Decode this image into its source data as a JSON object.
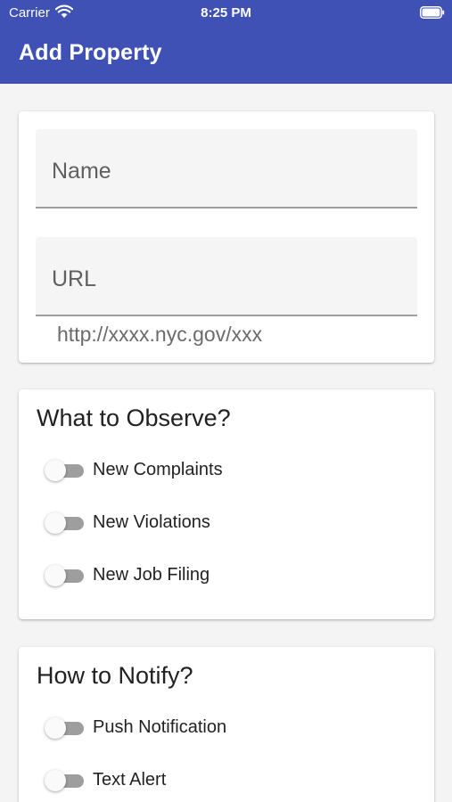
{
  "status_bar": {
    "carrier": "Carrier",
    "time": "8:25 PM",
    "icons": [
      "wifi-icon",
      "battery-icon"
    ]
  },
  "app_bar": {
    "title": "Add Property",
    "color": "#3f51b5"
  },
  "property_form": {
    "name_field": {
      "label": "Name",
      "value": ""
    },
    "url_field": {
      "label": "URL",
      "value": "",
      "helper_text": "http://xxxx.nyc.gov/xxx"
    }
  },
  "observe_section": {
    "title": "What to Observe?",
    "options": [
      {
        "label": "New Complaints",
        "enabled": false
      },
      {
        "label": "New Violations",
        "enabled": false
      },
      {
        "label": "New Job Filing",
        "enabled": false
      }
    ]
  },
  "notify_section": {
    "title": "How to Notify?",
    "options": [
      {
        "label": "Push Notification",
        "enabled": false
      },
      {
        "label": "Text Alert",
        "enabled": false
      }
    ]
  }
}
